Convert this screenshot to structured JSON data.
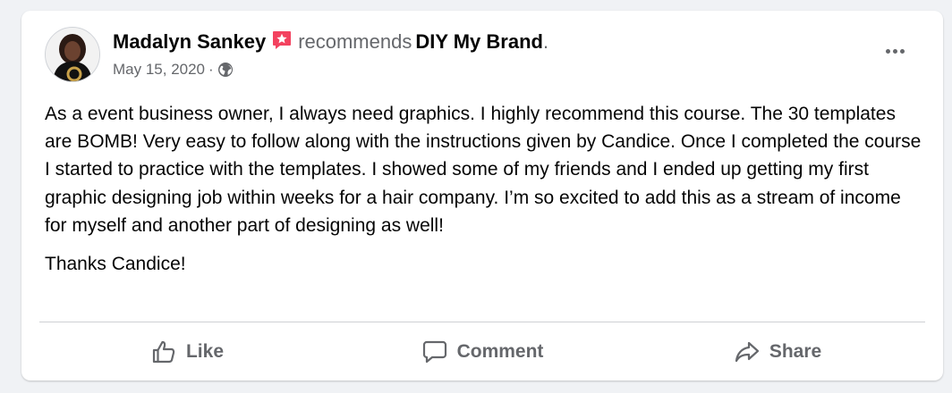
{
  "post": {
    "author": "Madalyn Sankey",
    "badge_icon": "recommendation-star-icon",
    "verb": "recommends",
    "page": "DIY My Brand",
    "period": ".",
    "date": "May 15, 2020",
    "separator": "·",
    "privacy_icon": "globe-icon",
    "paragraphs": [
      "As a event business owner, I always need graphics. I highly recommend this course. The 30 templates are BOMB! Very easy to follow along with the instructions given by Candice. Once I completed the course I started to practice with the templates. I showed some of my friends and I ended up getting my first graphic designing job within weeks for a hair company. I’m so excited to add this as a stream of income for myself and another part of designing as well!",
      "Thanks Candice!"
    ]
  },
  "actions": {
    "like": "Like",
    "comment": "Comment",
    "share": "Share"
  },
  "colors": {
    "badge": "#f3425f",
    "secondary_text": "#65676b",
    "primary_text": "#050505",
    "background": "#f0f2f5"
  }
}
